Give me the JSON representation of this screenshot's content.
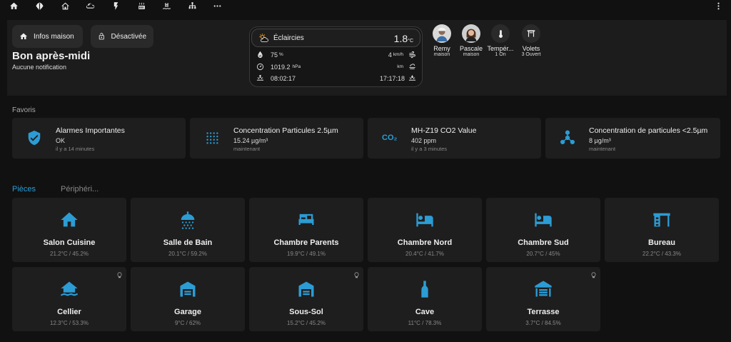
{
  "colors": {
    "accent": "#2c9cd4",
    "background": "#111111",
    "card": "#1e1e1e",
    "hero": "#1c1c1c"
  },
  "nav_icons": [
    "home-icon",
    "brain-icon",
    "house-outline-icon",
    "cloud-icon",
    "flash-icon",
    "radiator-icon",
    "pool-icon",
    "network-icon",
    "more-horizontal-icon",
    "more-vertical-icon"
  ],
  "header": {
    "infos_label": "Infos maison",
    "desactivee_label": "Désactivée",
    "greeting": "Bon après-midi",
    "notification": "Aucune notification"
  },
  "weather": {
    "condition": "Éclaircies",
    "temperature": "1.8",
    "temp_unit": "°C",
    "humidity": "75",
    "humidity_unit": "%",
    "wind": "4",
    "wind_unit": "km/h",
    "pressure": "1019.2",
    "pressure_unit": "hPa",
    "visibility_unit": "km",
    "sunrise": "08:02:17",
    "sunset": "17:17:18"
  },
  "people": [
    {
      "name": "Remy",
      "state": "maison"
    },
    {
      "name": "Pascale",
      "state": "maison"
    },
    {
      "name": "Tempér...",
      "state": "1 On"
    },
    {
      "name": "Volets",
      "state": "3 Ouvert"
    }
  ],
  "favoris": {
    "title": "Favoris",
    "items": [
      {
        "title": "Alarmes Importantes",
        "value": "OK",
        "time": "il y a 14 minutes",
        "icon": "shield-check-icon"
      },
      {
        "title": "Concentration Particules 2.5µm",
        "value": "15.24 µg/m³",
        "time": "maintenant",
        "icon": "dots-grid-icon"
      },
      {
        "title": "MH-Z19 CO2 Value",
        "value": "402 ppm",
        "time": "il y a 3 minutes",
        "icon": "co2-icon",
        "icon_text": "CO₂"
      },
      {
        "title": "Concentration de particules <2.5µm",
        "value": "8 µg/m³",
        "time": "maintenant",
        "icon": "molecule-icon"
      }
    ]
  },
  "tabs": [
    {
      "label": "Pièces",
      "active": true
    },
    {
      "label": "Périphéri...",
      "active": false
    }
  ],
  "rooms": [
    {
      "name": "Salon Cuisine",
      "value": "21.2°C / 45.2%",
      "icon": "home-icon"
    },
    {
      "name": "Salle de Bain",
      "value": "20.1°C / 59.2%",
      "icon": "shower-icon"
    },
    {
      "name": "Chambre Parents",
      "value": "19.9°C / 49.1%",
      "icon": "double-bed-icon"
    },
    {
      "name": "Chambre Nord",
      "value": "20.4°C / 41.7%",
      "icon": "bed-icon"
    },
    {
      "name": "Chambre Sud",
      "value": "20.7°C / 45%",
      "icon": "bed-icon"
    },
    {
      "name": "Bureau",
      "value": "22.2°C / 43.3%",
      "icon": "desk-icon"
    },
    {
      "name": "Cellier",
      "value": "12.3°C / 53.3%",
      "icon": "home-flood-icon",
      "bulb": true
    },
    {
      "name": "Garage",
      "value": "9°C / 62%",
      "icon": "garage-icon"
    },
    {
      "name": "Sous-Sol",
      "value": "15.2°C / 45.2%",
      "icon": "garage-icon",
      "bulb": true
    },
    {
      "name": "Cave",
      "value": "11°C / 78.3%",
      "icon": "bottle-icon"
    },
    {
      "name": "Terrasse",
      "value": "3.7°C / 84.5%",
      "icon": "terrace-icon",
      "bulb": true
    }
  ]
}
